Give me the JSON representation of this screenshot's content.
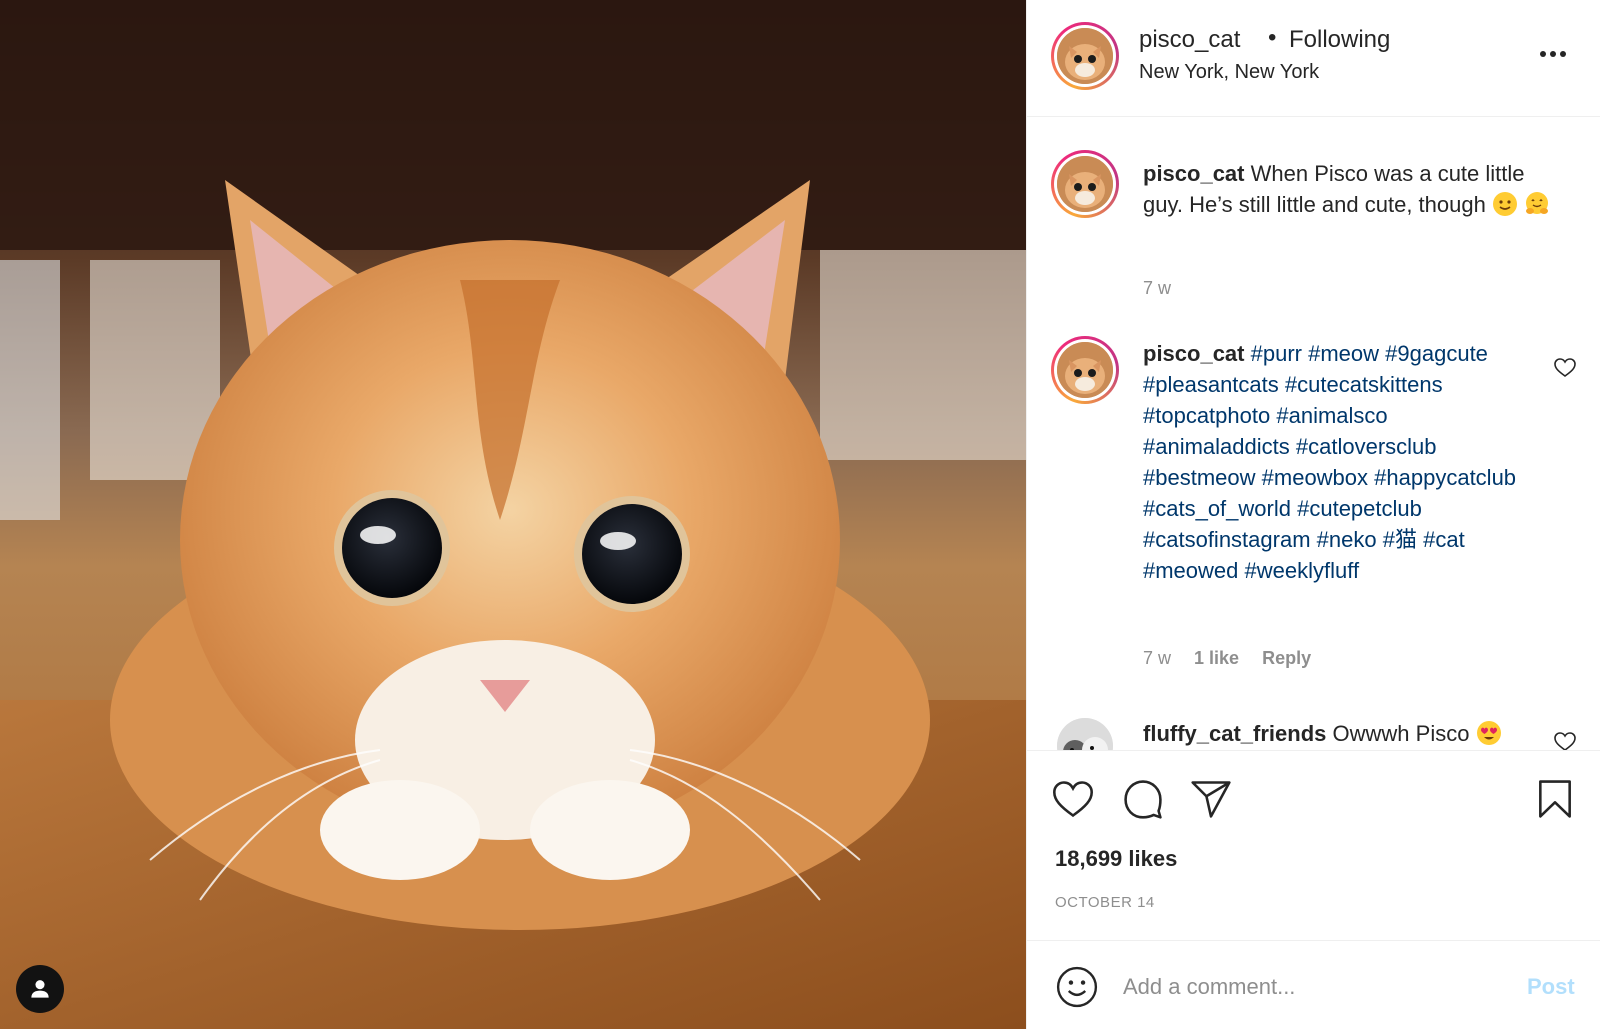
{
  "header": {
    "username": "pisco_cat",
    "separator": "•",
    "follow_status": "Following",
    "location": "New York, New York"
  },
  "comments": [
    {
      "username": "pisco_cat",
      "text": "When Pisco was a cute little guy. He’s still little and cute, though",
      "emojis": [
        "smiling-face-emoji",
        "hugging-face-emoji"
      ],
      "time": "7 w"
    },
    {
      "username": "pisco_cat",
      "hashtags": [
        "#purr",
        "#meow",
        "#9gagcute",
        "#pleasantcats",
        "#cutecatskittens",
        "#topcatphoto",
        "#animalsco",
        "#animaladdicts",
        "#catloversclub",
        "#bestmeow",
        "#meowbox",
        "#happycatclub",
        "#cats_of_world",
        "#cutepetclub",
        "#catsofinstagram",
        "#neko",
        "#猫",
        "#cat",
        "#meowed",
        "#weeklyfluff"
      ],
      "time": "7 w",
      "likes": "1 like",
      "reply": "Reply"
    },
    {
      "username": "fluffy_cat_friends",
      "text": "Owwwh Pisco",
      "emojis": [
        "heart-eyes-emoji"
      ]
    }
  ],
  "actions": {
    "likes": "18,699 likes",
    "date": "OCTOBER 14"
  },
  "comment_box": {
    "placeholder": "Add a comment...",
    "post_label": "Post"
  },
  "icons": {
    "more": "more-options-icon",
    "like": "heart-icon",
    "comment": "comment-bubble-icon",
    "share": "paper-plane-icon",
    "save": "bookmark-icon",
    "emoji": "smiley-icon",
    "tag": "user-tag-icon"
  },
  "colors": {
    "hashtag": "#00376b",
    "secondary_text": "#8e8e8e",
    "post_disabled": "#b2dffc",
    "border": "#efefef"
  }
}
